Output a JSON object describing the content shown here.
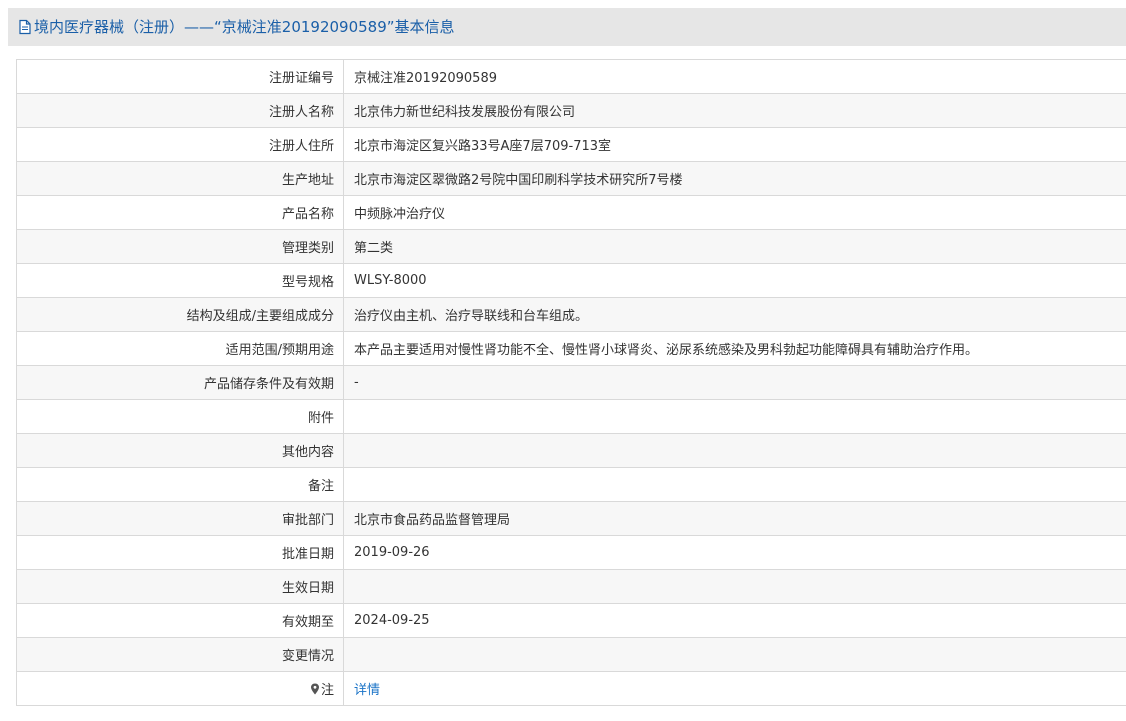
{
  "header": {
    "title": "境内医疗器械（注册）——“京械注准20192090589”基本信息",
    "icon": "document-icon",
    "title_color": "#1a5fa8",
    "background_color": "#e6e6e6"
  },
  "rows": [
    {
      "label": "注册证编号",
      "value": "京械注准20192090589"
    },
    {
      "label": "注册人名称",
      "value": "北京伟力新世纪科技发展股份有限公司"
    },
    {
      "label": "注册人住所",
      "value": "北京市海淀区复兴路33号A座7层709-713室"
    },
    {
      "label": "生产地址",
      "value": "北京市海淀区翠微路2号院中国印刷科学技术研究所7号楼"
    },
    {
      "label": "产品名称",
      "value": "中频脉冲治疗仪"
    },
    {
      "label": "管理类别",
      "value": "第二类"
    },
    {
      "label": "型号规格",
      "value": "WLSY-8000"
    },
    {
      "label": "结构及组成/主要组成成分",
      "value": "治疗仪由主机、治疗导联线和台车组成。"
    },
    {
      "label": "适用范围/预期用途",
      "value": "本产品主要适用对慢性肾功能不全、慢性肾小球肾炎、泌尿系统感染及男科勃起功能障碍具有辅助治疗作用。"
    },
    {
      "label": "产品储存条件及有效期",
      "value": "-"
    },
    {
      "label": "附件",
      "value": ""
    },
    {
      "label": "其他内容",
      "value": ""
    },
    {
      "label": "备注",
      "value": ""
    },
    {
      "label": "审批部门",
      "value": "北京市食品药品监督管理局"
    },
    {
      "label": "批准日期",
      "value": "2019-09-26"
    },
    {
      "label": "生效日期",
      "value": ""
    },
    {
      "label": "有效期至",
      "value": "2024-09-25"
    },
    {
      "label": "变更情况",
      "value": ""
    }
  ],
  "note_row": {
    "icon": "map-pin-icon",
    "label": "注",
    "link_text": "详情",
    "link_color": "#1a73c7"
  }
}
